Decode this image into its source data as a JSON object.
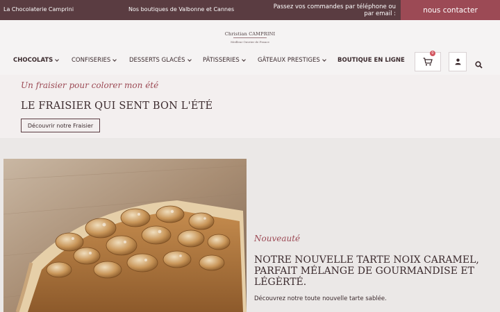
{
  "topbar": {
    "brand": "La Chocolaterie Camprini",
    "stores": "Nos boutiques de Valbonne et Cannes",
    "order_info": "Passez vos commandes par téléphone ou par email :",
    "contact_button": "nous contacter"
  },
  "logo": {
    "name": "Christian CAMPRINI",
    "subtitle": "Meilleur Ouvrier de France"
  },
  "nav": {
    "items": [
      {
        "label": "CHOCOLATS"
      },
      {
        "label": "CONFISERIES"
      },
      {
        "label": "DESSERTS GLACÉS"
      },
      {
        "label": "PÂTISSERIES"
      },
      {
        "label": "GÂTEAUX PRESTIGES"
      },
      {
        "label": "BOUTIQUE EN LIGNE"
      }
    ],
    "cart_count": "0"
  },
  "hero": {
    "script": "Un fraisier pour colorer mon été",
    "title": "LE FRAISIER QUI SENT BON L'ÉTÉ",
    "button": "Découvrir notre Fraisier"
  },
  "product": {
    "script": "Nouveauté",
    "title": "NOTRE NOUVELLE TARTE NOIX CARAMEL, PARFAIT MÉLANGE DE GOURMANDISE ET LÉGÈRTÉ.",
    "description": "Découvrez notre toute nouvelle tarte sablée."
  },
  "colors": {
    "topbar": "#5a3c41",
    "accent": "#9c4a55",
    "text": "#3b2a2d"
  },
  "icons": [
    "cart-icon",
    "user-icon",
    "search-icon"
  ]
}
